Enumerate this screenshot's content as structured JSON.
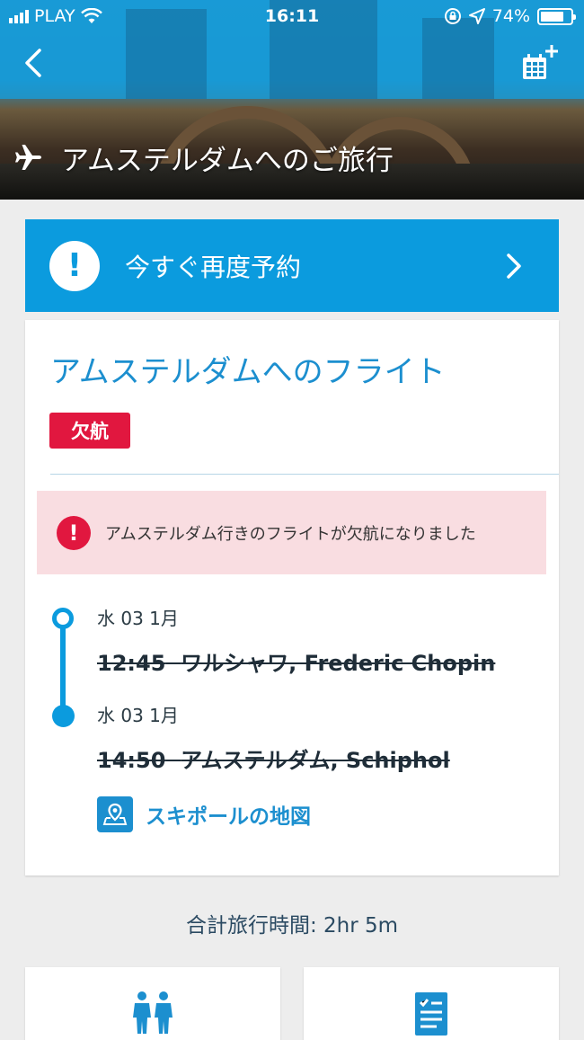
{
  "status_bar": {
    "carrier": "PLAY",
    "time": "16:11",
    "battery": "74%"
  },
  "header": {
    "trip_title": "アムステルダムへのご旅行"
  },
  "rebook": {
    "label": "今すぐ再度予約"
  },
  "flight_card": {
    "title": "アムステルダムへのフライト",
    "badge": "欠航",
    "cancel_message": "アムステルダム行きのフライトが欠航になりました",
    "departure": {
      "date": "水 03 1月",
      "time": "12:45",
      "place": "ワルシャワ, Frederic Chopin"
    },
    "arrival": {
      "date": "水 03 1月",
      "time": "14:50",
      "place": "アムステルダム, Schiphol"
    },
    "map_link": "スキポールの地図"
  },
  "total_travel_time": "合計旅行時間: 2hr 5m",
  "colors": {
    "accent": "#0b9bde",
    "link": "#1c8fcf",
    "cancel_red": "#e1173f",
    "cancel_bg": "#f9dde1"
  }
}
